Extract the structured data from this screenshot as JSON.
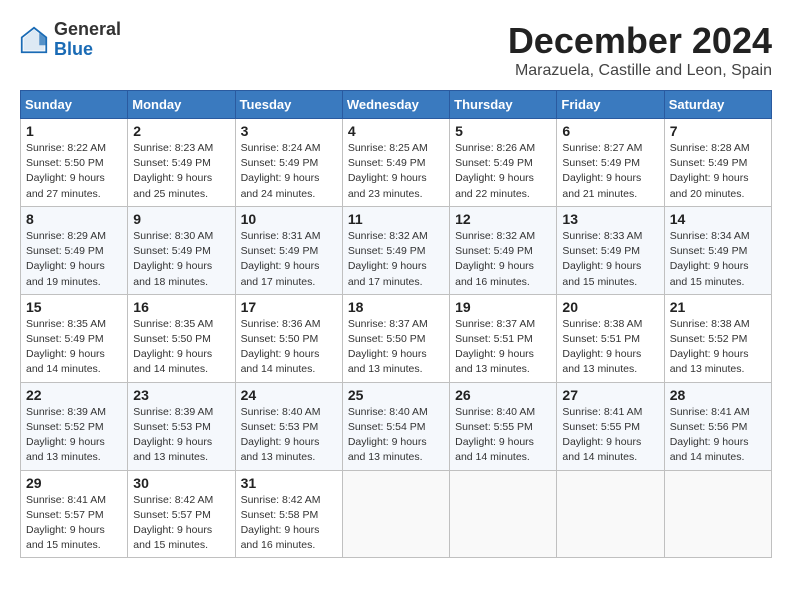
{
  "header": {
    "logo_general": "General",
    "logo_blue": "Blue",
    "month_title": "December 2024",
    "location": "Marazuela, Castille and Leon, Spain"
  },
  "weekdays": [
    "Sunday",
    "Monday",
    "Tuesday",
    "Wednesday",
    "Thursday",
    "Friday",
    "Saturday"
  ],
  "weeks": [
    [
      {
        "day": "1",
        "info": "Sunrise: 8:22 AM\nSunset: 5:50 PM\nDaylight: 9 hours and 27 minutes."
      },
      {
        "day": "2",
        "info": "Sunrise: 8:23 AM\nSunset: 5:49 PM\nDaylight: 9 hours and 25 minutes."
      },
      {
        "day": "3",
        "info": "Sunrise: 8:24 AM\nSunset: 5:49 PM\nDaylight: 9 hours and 24 minutes."
      },
      {
        "day": "4",
        "info": "Sunrise: 8:25 AM\nSunset: 5:49 PM\nDaylight: 9 hours and 23 minutes."
      },
      {
        "day": "5",
        "info": "Sunrise: 8:26 AM\nSunset: 5:49 PM\nDaylight: 9 hours and 22 minutes."
      },
      {
        "day": "6",
        "info": "Sunrise: 8:27 AM\nSunset: 5:49 PM\nDaylight: 9 hours and 21 minutes."
      },
      {
        "day": "7",
        "info": "Sunrise: 8:28 AM\nSunset: 5:49 PM\nDaylight: 9 hours and 20 minutes."
      }
    ],
    [
      {
        "day": "8",
        "info": "Sunrise: 8:29 AM\nSunset: 5:49 PM\nDaylight: 9 hours and 19 minutes."
      },
      {
        "day": "9",
        "info": "Sunrise: 8:30 AM\nSunset: 5:49 PM\nDaylight: 9 hours and 18 minutes."
      },
      {
        "day": "10",
        "info": "Sunrise: 8:31 AM\nSunset: 5:49 PM\nDaylight: 9 hours and 17 minutes."
      },
      {
        "day": "11",
        "info": "Sunrise: 8:32 AM\nSunset: 5:49 PM\nDaylight: 9 hours and 17 minutes."
      },
      {
        "day": "12",
        "info": "Sunrise: 8:32 AM\nSunset: 5:49 PM\nDaylight: 9 hours and 16 minutes."
      },
      {
        "day": "13",
        "info": "Sunrise: 8:33 AM\nSunset: 5:49 PM\nDaylight: 9 hours and 15 minutes."
      },
      {
        "day": "14",
        "info": "Sunrise: 8:34 AM\nSunset: 5:49 PM\nDaylight: 9 hours and 15 minutes."
      }
    ],
    [
      {
        "day": "15",
        "info": "Sunrise: 8:35 AM\nSunset: 5:49 PM\nDaylight: 9 hours and 14 minutes."
      },
      {
        "day": "16",
        "info": "Sunrise: 8:35 AM\nSunset: 5:50 PM\nDaylight: 9 hours and 14 minutes."
      },
      {
        "day": "17",
        "info": "Sunrise: 8:36 AM\nSunset: 5:50 PM\nDaylight: 9 hours and 14 minutes."
      },
      {
        "day": "18",
        "info": "Sunrise: 8:37 AM\nSunset: 5:50 PM\nDaylight: 9 hours and 13 minutes."
      },
      {
        "day": "19",
        "info": "Sunrise: 8:37 AM\nSunset: 5:51 PM\nDaylight: 9 hours and 13 minutes."
      },
      {
        "day": "20",
        "info": "Sunrise: 8:38 AM\nSunset: 5:51 PM\nDaylight: 9 hours and 13 minutes."
      },
      {
        "day": "21",
        "info": "Sunrise: 8:38 AM\nSunset: 5:52 PM\nDaylight: 9 hours and 13 minutes."
      }
    ],
    [
      {
        "day": "22",
        "info": "Sunrise: 8:39 AM\nSunset: 5:52 PM\nDaylight: 9 hours and 13 minutes."
      },
      {
        "day": "23",
        "info": "Sunrise: 8:39 AM\nSunset: 5:53 PM\nDaylight: 9 hours and 13 minutes."
      },
      {
        "day": "24",
        "info": "Sunrise: 8:40 AM\nSunset: 5:53 PM\nDaylight: 9 hours and 13 minutes."
      },
      {
        "day": "25",
        "info": "Sunrise: 8:40 AM\nSunset: 5:54 PM\nDaylight: 9 hours and 13 minutes."
      },
      {
        "day": "26",
        "info": "Sunrise: 8:40 AM\nSunset: 5:55 PM\nDaylight: 9 hours and 14 minutes."
      },
      {
        "day": "27",
        "info": "Sunrise: 8:41 AM\nSunset: 5:55 PM\nDaylight: 9 hours and 14 minutes."
      },
      {
        "day": "28",
        "info": "Sunrise: 8:41 AM\nSunset: 5:56 PM\nDaylight: 9 hours and 14 minutes."
      }
    ],
    [
      {
        "day": "29",
        "info": "Sunrise: 8:41 AM\nSunset: 5:57 PM\nDaylight: 9 hours and 15 minutes."
      },
      {
        "day": "30",
        "info": "Sunrise: 8:42 AM\nSunset: 5:57 PM\nDaylight: 9 hours and 15 minutes."
      },
      {
        "day": "31",
        "info": "Sunrise: 8:42 AM\nSunset: 5:58 PM\nDaylight: 9 hours and 16 minutes."
      },
      null,
      null,
      null,
      null
    ]
  ]
}
